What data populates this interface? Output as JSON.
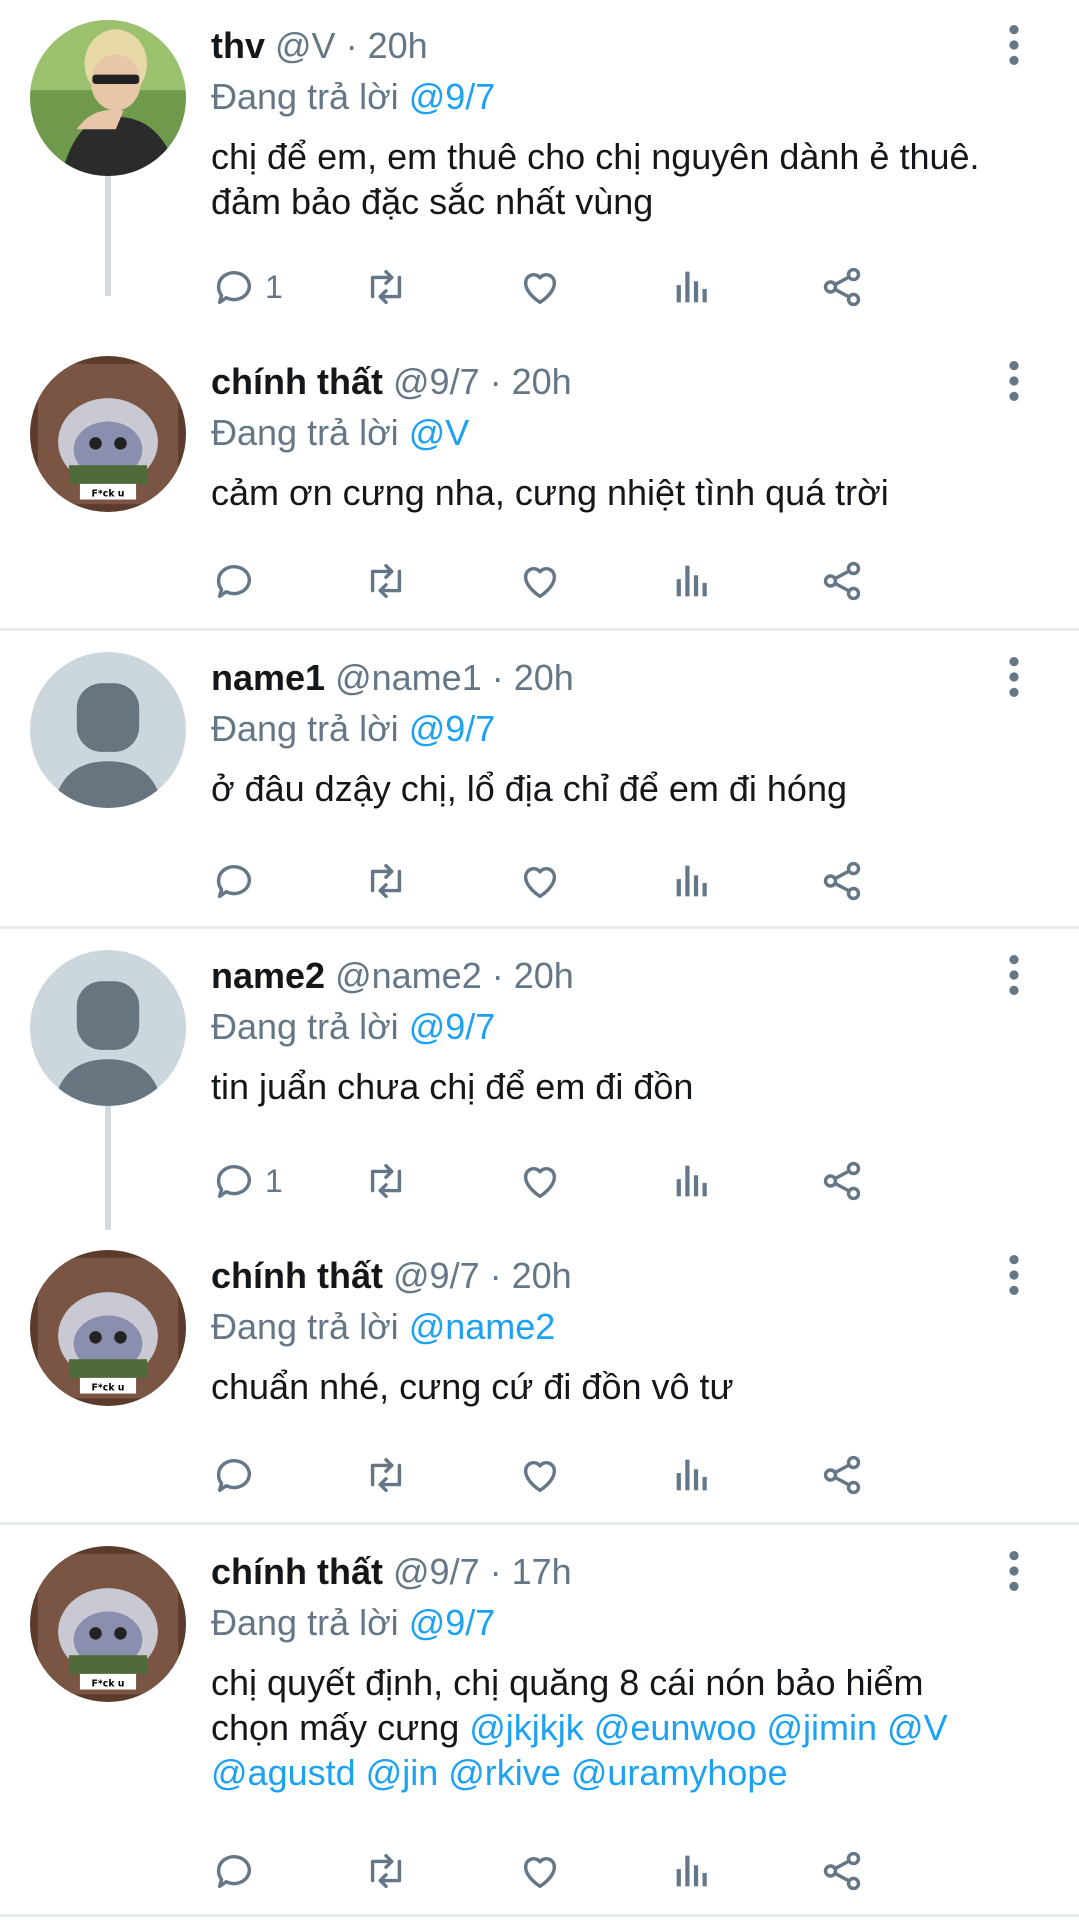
{
  "colors": {
    "accent": "#1da1f2",
    "muted": "#657786",
    "text": "#14171a",
    "divider": "#e6ecf0"
  },
  "reply_prefix": "Đang trả lời",
  "tweets": [
    {
      "name": "thv",
      "handle": "@V",
      "time": "20h",
      "reply_to": "@9/7",
      "text_plain": "chị để em, em thuê cho chị nguyên dành ẻ thuê.\nđảm bảo đặc sắc nhất vùng",
      "reply_count": "1",
      "avatar": "photo-avatar"
    },
    {
      "name": "chính thất",
      "handle": "@9/7",
      "time": "20h",
      "reply_to": "@V",
      "text_plain": "cảm ơn cưng nha, cưng nhiệt tình quá trời",
      "reply_count": "",
      "avatar": "cartoon-avatar",
      "avatar_caption": "F*ck u"
    },
    {
      "name": "name1",
      "handle": "@name1",
      "time": "20h",
      "reply_to": "@9/7",
      "text_plain": "ở đâu dzậy chị, lổ địa chỉ để em đi hóng",
      "reply_count": "",
      "avatar": "default-avatar"
    },
    {
      "name": "name2",
      "handle": "@name2",
      "time": "20h",
      "reply_to": "@9/7",
      "text_plain": "tin juẩn chưa chị để em đi đồn",
      "reply_count": "1",
      "avatar": "default-avatar"
    },
    {
      "name": "chính thất",
      "handle": "@9/7",
      "time": "20h",
      "reply_to": "@name2",
      "text_plain": "chuẩn nhé, cưng cứ đi đồn vô tư",
      "reply_count": "",
      "avatar": "cartoon-avatar",
      "avatar_caption": "F*ck u"
    },
    {
      "name": "chính thất",
      "handle": "@9/7",
      "time": "17h",
      "reply_to": "@9/7",
      "text_line1": "chị quyết định, chị quăng 8 cái nón bảo hiểm",
      "text_line2_prefix": "chọn mấy cưng ",
      "mentions": [
        "@jkjkjk",
        "@eunwoo",
        "@jimin",
        "@V",
        "@agustd",
        "@jin",
        "@rkive",
        "@uramyhope"
      ],
      "reply_count": "",
      "avatar": "cartoon-avatar",
      "avatar_caption": "F*ck u"
    }
  ],
  "icons": [
    "reply-icon",
    "retweet-icon",
    "like-icon",
    "analytics-icon",
    "share-icon",
    "more-icon"
  ]
}
